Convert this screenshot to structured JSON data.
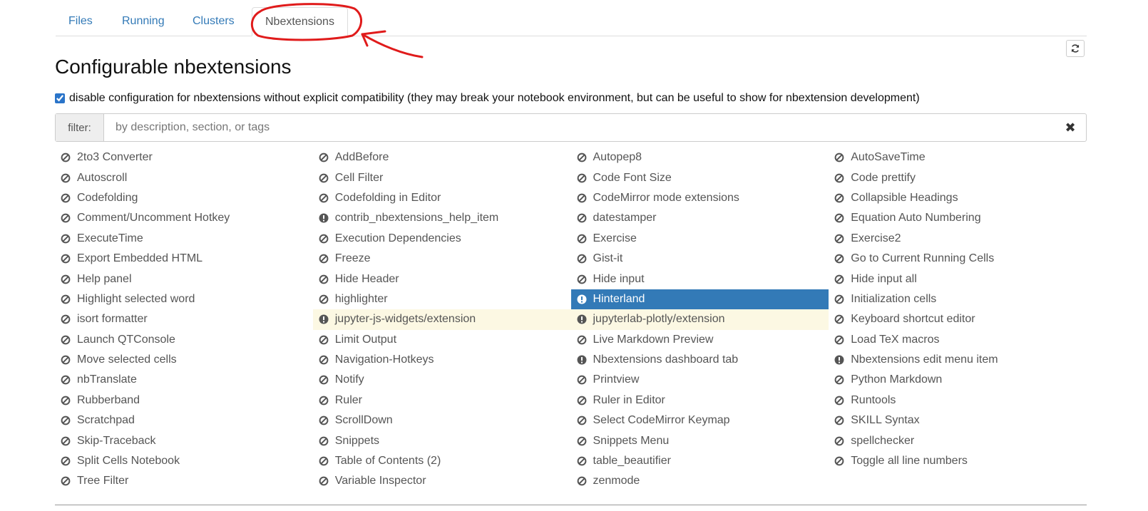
{
  "tabs": [
    {
      "label": "Files",
      "active": false
    },
    {
      "label": "Running",
      "active": false
    },
    {
      "label": "Clusters",
      "active": false
    },
    {
      "label": "Nbextensions",
      "active": true
    }
  ],
  "page_title": "Configurable nbextensions",
  "compat_checkbox": {
    "checked": true,
    "label": "disable configuration for nbextensions without explicit compatibility (they may break your notebook environment, but can be useful to show for nbextension development)"
  },
  "filter": {
    "label": "filter:",
    "placeholder": "by description, section, or tags",
    "value": ""
  },
  "icons": {
    "refresh": "refresh-icon",
    "clear": "clear-filter-icon",
    "disabled": "ban-icon",
    "incompatible": "exclamation-circle-icon"
  },
  "colors": {
    "link": "#337ab7",
    "selected_bg": "#337ab7",
    "warning_bg": "#fcf8e3",
    "annotation": "#e01b1b"
  },
  "extensions": [
    {
      "label": "2to3 Converter",
      "status": "disabled"
    },
    {
      "label": "AddBefore",
      "status": "disabled"
    },
    {
      "label": "Autopep8",
      "status": "disabled"
    },
    {
      "label": "AutoSaveTime",
      "status": "disabled"
    },
    {
      "label": "Autoscroll",
      "status": "disabled"
    },
    {
      "label": "Cell Filter",
      "status": "disabled"
    },
    {
      "label": "Code Font Size",
      "status": "disabled"
    },
    {
      "label": "Code prettify",
      "status": "disabled"
    },
    {
      "label": "Codefolding",
      "status": "disabled"
    },
    {
      "label": "Codefolding in Editor",
      "status": "disabled"
    },
    {
      "label": "CodeMirror mode extensions",
      "status": "disabled"
    },
    {
      "label": "Collapsible Headings",
      "status": "disabled"
    },
    {
      "label": "Comment/Uncomment Hotkey",
      "status": "disabled"
    },
    {
      "label": "contrib_nbextensions_help_item",
      "status": "incompatible"
    },
    {
      "label": "datestamper",
      "status": "disabled"
    },
    {
      "label": "Equation Auto Numbering",
      "status": "disabled"
    },
    {
      "label": "ExecuteTime",
      "status": "disabled"
    },
    {
      "label": "Execution Dependencies",
      "status": "disabled"
    },
    {
      "label": "Exercise",
      "status": "disabled"
    },
    {
      "label": "Exercise2",
      "status": "disabled"
    },
    {
      "label": "Export Embedded HTML",
      "status": "disabled"
    },
    {
      "label": "Freeze",
      "status": "disabled"
    },
    {
      "label": "Gist-it",
      "status": "disabled"
    },
    {
      "label": "Go to Current Running Cells",
      "status": "disabled"
    },
    {
      "label": "Help panel",
      "status": "disabled"
    },
    {
      "label": "Hide Header",
      "status": "disabled"
    },
    {
      "label": "Hide input",
      "status": "disabled"
    },
    {
      "label": "Hide input all",
      "status": "disabled"
    },
    {
      "label": "Highlight selected word",
      "status": "disabled"
    },
    {
      "label": "highlighter",
      "status": "disabled"
    },
    {
      "label": "Hinterland",
      "status": "incompatible",
      "selected": true
    },
    {
      "label": "Initialization cells",
      "status": "disabled"
    },
    {
      "label": "isort formatter",
      "status": "disabled"
    },
    {
      "label": "jupyter-js-widgets/extension",
      "status": "incompatible",
      "warning": true
    },
    {
      "label": "jupyterlab-plotly/extension",
      "status": "incompatible",
      "warning": true
    },
    {
      "label": "Keyboard shortcut editor",
      "status": "disabled"
    },
    {
      "label": "Launch QTConsole",
      "status": "disabled"
    },
    {
      "label": "Limit Output",
      "status": "disabled"
    },
    {
      "label": "Live Markdown Preview",
      "status": "disabled"
    },
    {
      "label": "Load TeX macros",
      "status": "disabled"
    },
    {
      "label": "Move selected cells",
      "status": "disabled"
    },
    {
      "label": "Navigation-Hotkeys",
      "status": "disabled"
    },
    {
      "label": "Nbextensions dashboard tab",
      "status": "incompatible"
    },
    {
      "label": "Nbextensions edit menu item",
      "status": "incompatible"
    },
    {
      "label": "nbTranslate",
      "status": "disabled"
    },
    {
      "label": "Notify",
      "status": "disabled"
    },
    {
      "label": "Printview",
      "status": "disabled"
    },
    {
      "label": "Python Markdown",
      "status": "disabled"
    },
    {
      "label": "Rubberband",
      "status": "disabled"
    },
    {
      "label": "Ruler",
      "status": "disabled"
    },
    {
      "label": "Ruler in Editor",
      "status": "disabled"
    },
    {
      "label": "Runtools",
      "status": "disabled"
    },
    {
      "label": "Scratchpad",
      "status": "disabled"
    },
    {
      "label": "ScrollDown",
      "status": "disabled"
    },
    {
      "label": "Select CodeMirror Keymap",
      "status": "disabled"
    },
    {
      "label": "SKILL Syntax",
      "status": "disabled"
    },
    {
      "label": "Skip-Traceback",
      "status": "disabled"
    },
    {
      "label": "Snippets",
      "status": "disabled"
    },
    {
      "label": "Snippets Menu",
      "status": "disabled"
    },
    {
      "label": "spellchecker",
      "status": "disabled"
    },
    {
      "label": "Split Cells Notebook",
      "status": "disabled"
    },
    {
      "label": "Table of Contents (2)",
      "status": "disabled"
    },
    {
      "label": "table_beautifier",
      "status": "disabled"
    },
    {
      "label": "Toggle all line numbers",
      "status": "disabled"
    },
    {
      "label": "Tree Filter",
      "status": "disabled"
    },
    {
      "label": "Variable Inspector",
      "status": "disabled"
    },
    {
      "label": "zenmode",
      "status": "disabled"
    }
  ]
}
